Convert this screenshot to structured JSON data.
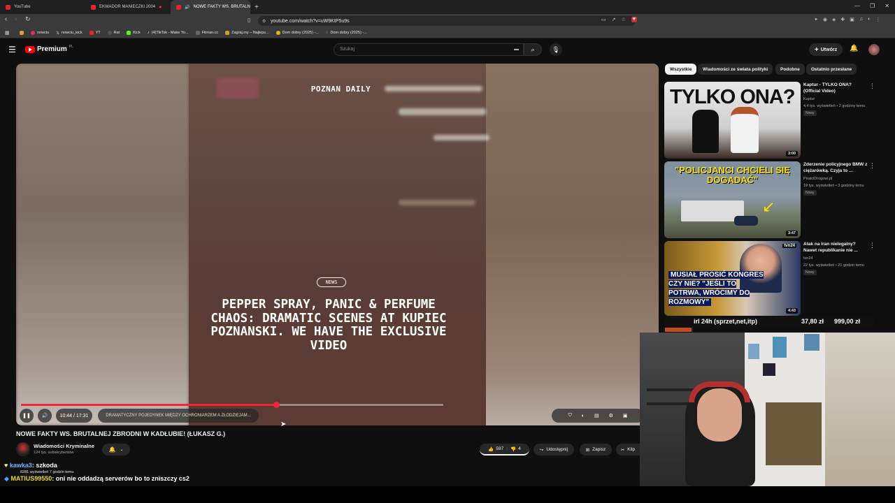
{
  "browser": {
    "tabs": [
      {
        "label": "YouTube",
        "active": false
      },
      {
        "label": "EKWADOR MANIECZKI 2004",
        "active": false
      },
      {
        "label": "NOWE FAKTY WS. BRUTALN",
        "active": true
      }
    ],
    "url": "youtube.com/watch?v=uW9KtP5u9s",
    "bookmarks": [
      "nowciu",
      "nowciu_kick",
      "YT",
      "Rat",
      "Kick",
      "(4)TikTok - Make Yo...",
      "Filman.cc",
      "Zagraj.my – Najleps...",
      "Dom dobry (2025) -...",
      "Dom dobry (2025) -..."
    ]
  },
  "youtube": {
    "logo": "Premium",
    "logo_region": "PL",
    "search_placeholder": "Szukaj",
    "create_label": "Utwórz"
  },
  "video": {
    "brand": "POZNAN DAILY",
    "badge": "NEWS",
    "headline": "PEPPER SPRAY, PANIC & PERFUME CHAOS: DRAMATIC SCENES AT KUPIEC POZNANSKI. WE HAVE THE EXCLUSIVE VIDEO",
    "time": "10:44 / 17:31",
    "progress": 0.605,
    "chapter": "DRAMATYCZNY POJEDYNEK MIĘDZY OCHRONIARZEM A ZŁODZIEJAM...",
    "title": "NOWE FAKTY WS. BRUTALNEJ ZBRODNI W KADŁUBIE! (ŁUKASZ G.)",
    "channel": "Wiadomości Kryminalne",
    "subscribers": "124 tys. subskrybentów",
    "likes": "597",
    "dislikes": "4",
    "share_label": "Udostępnij",
    "save_label": "Zapisz",
    "clip_label": "Klip",
    "views_meta": "8281 wyświetleń  7 godzin temu"
  },
  "chat": [
    {
      "user": "kawka3",
      "message": ": szkoda"
    },
    {
      "user": "MATIUS99550",
      "message": ": oni nie oddadzą serverów bo to zniszczy cs2"
    }
  ],
  "filters": [
    "Wszystkie",
    "Wiadomości ze świata polityki",
    "Podobne",
    "Ostatnio przesłane"
  ],
  "recommendations": [
    {
      "title": "Kaptur - TYLKO ONA? (Official Video)",
      "channel": "Kaptur",
      "meta": "4,4 tys. wyświetleń • 2 godziny temu",
      "badge": "Nowy",
      "duration": "3:00",
      "thumb_text": "TYLKO ONA?"
    },
    {
      "title": "Zderzenie policyjnego BMW z ciężarówką. Czyja to ...",
      "channel": "PiratciDrogowi.pl",
      "meta": "19 tys. wyświetleń • 3 godziny temu",
      "badge": "Nowy",
      "duration": "3:47",
      "thumb_text": "\"POLICJANCI CHCIELI SIĘ DOGADAĆ\""
    },
    {
      "title": "Atak na Iran nielegalny? Nawet republikanie nie ...",
      "channel": "tvn24",
      "meta": "22 tys. wyświetleń • 21 godzin temu",
      "badge": "Nowy",
      "duration": "4:43",
      "thumb_text": "MUSIAŁ PROSIĆ KONGRES CZY NIE? \"JEŚLI TO POTRWA, WRÓCIMY DO ROZMOWY\"",
      "thumb_logo": "tvn24"
    }
  ],
  "donation_bar": {
    "label": "irl 24h (sprzet,net,itp)",
    "current": "37,80 zł",
    "goal": "999,00 zł"
  }
}
